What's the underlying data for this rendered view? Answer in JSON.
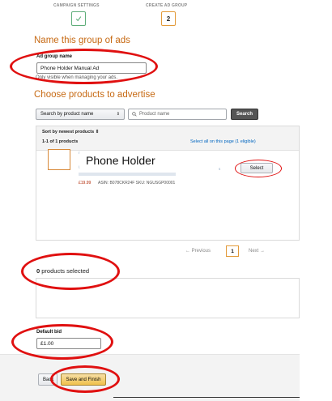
{
  "stepper": {
    "step1_label": "CAMPAIGN SETTINGS",
    "step2_label": "CREATE AD GROUP",
    "step2_number": "2"
  },
  "ad_group": {
    "section_title": "Name this group of ads",
    "name_label": "Ad group name",
    "name_value": "Phone Holder Manual Ad",
    "name_hint": "Only visible when managing your ads."
  },
  "products": {
    "section_title": "Choose products to advertise",
    "search_by": "Search by product name",
    "search_placeholder": "Product name",
    "search_button": "Search",
    "sort_label": "Sort by newest products",
    "count_label": "1-1 of 1 products",
    "select_all": "Select all on this page (1 eligible)",
    "item": {
      "title": "Phone Holder",
      "price": "£19.99",
      "asin_sku": "ASIN: B078CKR24F   SKU: NGUSGP00001",
      "select_button": "Select"
    }
  },
  "pagination": {
    "previous": "Previous",
    "current_page": "1",
    "next": "Next"
  },
  "selection": {
    "count": "0",
    "text": "products selected"
  },
  "bid": {
    "label": "Default bid",
    "value": "£1.00"
  },
  "footer": {
    "back_button": "Back",
    "save_button": "Save and Finish"
  },
  "colors": {
    "section_title": "#c76a14",
    "annotation": "#e01010",
    "primary_button": "#f0c14b",
    "step_done": "#5fae7a",
    "step_current": "#e29a3a"
  }
}
